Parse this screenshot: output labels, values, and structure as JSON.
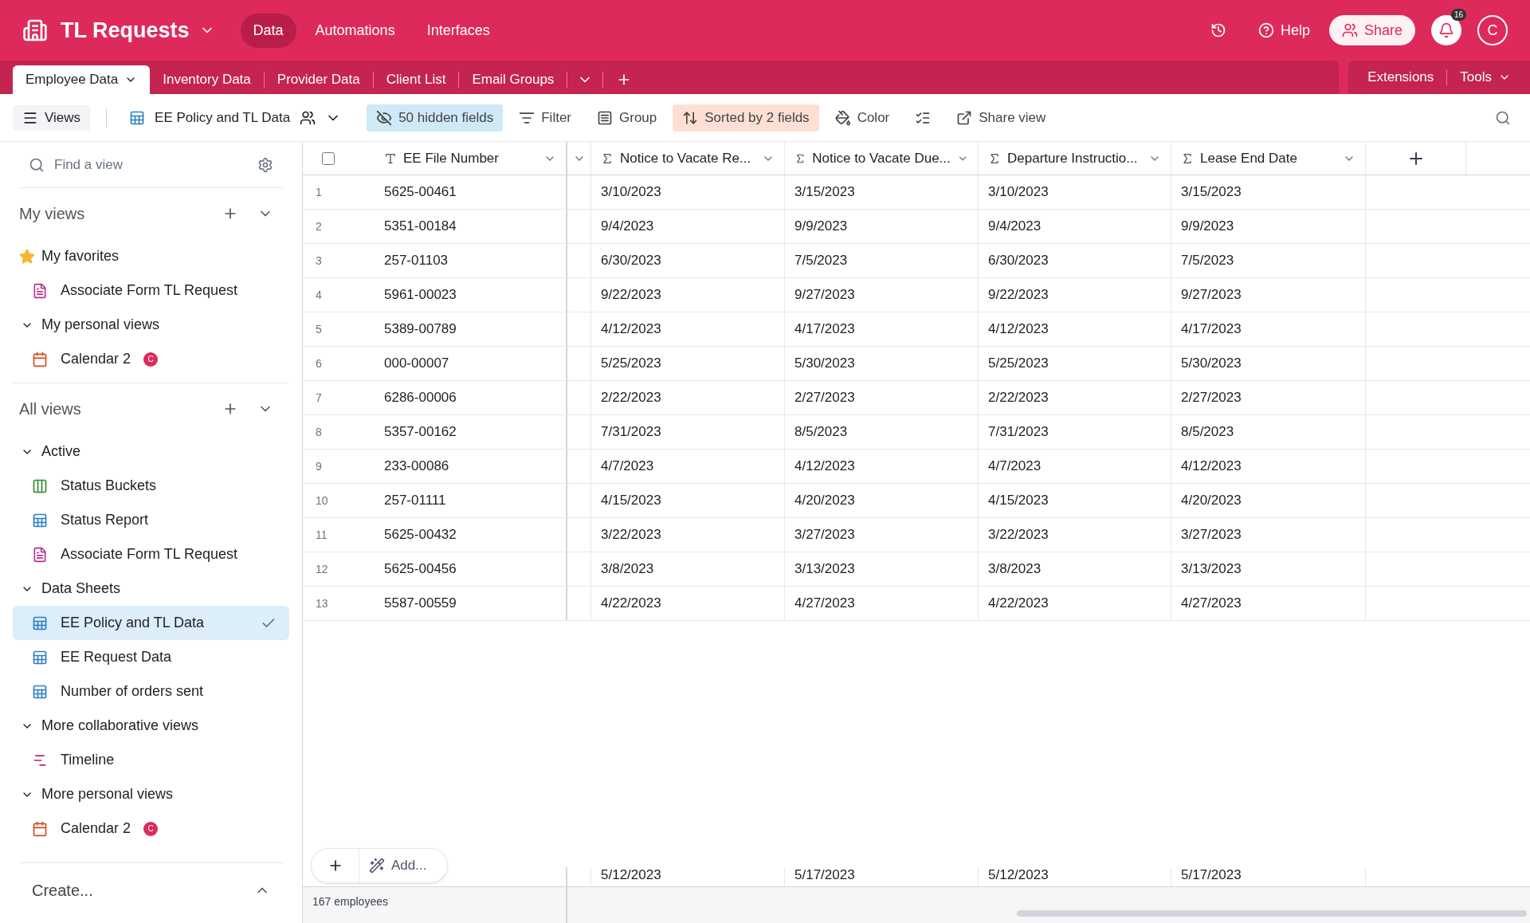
{
  "app": {
    "title": "TL Requests",
    "nav": [
      {
        "label": "Data",
        "selected": true
      },
      {
        "label": "Automations",
        "selected": false
      },
      {
        "label": "Interfaces",
        "selected": false
      }
    ],
    "help": "Help",
    "share": "Share",
    "notifications": "16",
    "avatar": "C"
  },
  "tables": [
    {
      "label": "Employee Data",
      "selected": true
    },
    {
      "label": "Inventory Data",
      "selected": false
    },
    {
      "label": "Provider Data",
      "selected": false
    },
    {
      "label": "Client List",
      "selected": false
    },
    {
      "label": "Email Groups",
      "selected": false
    }
  ],
  "tools": [
    "Extensions",
    "Tools"
  ],
  "toolbar": {
    "views": "Views",
    "current_view": "EE Policy and TL Data",
    "hidden_fields": "50 hidden fields",
    "filter": "Filter",
    "group": "Group",
    "sort": "Sorted by 2 fields",
    "color_button": "Color",
    "share_view": "Share view"
  },
  "sidebar": {
    "search_placeholder": "Find a view",
    "sections": [
      {
        "title": "My views",
        "groups": [
          {
            "title": "My favorites",
            "kind": "favorites",
            "items": [
              {
                "label": "Associate Form TL Request",
                "kind": "form",
                "selected": false
              }
            ]
          },
          {
            "title": "My personal views",
            "kind": "folder",
            "expanded": true,
            "items": [
              {
                "label": "Calendar 2",
                "kind": "calendar",
                "selected": false,
                "badge": "C"
              }
            ]
          }
        ]
      },
      {
        "title": "All views",
        "groups": [
          {
            "title": "Active",
            "kind": "folder",
            "expanded": true,
            "items": [
              {
                "label": "Status Buckets",
                "kind": "kanban",
                "selected": false
              },
              {
                "label": "Status Report",
                "kind": "grid",
                "selected": false
              },
              {
                "label": "Associate Form TL Request",
                "kind": "form",
                "selected": false
              }
            ]
          },
          {
            "title": "Data Sheets",
            "kind": "folder",
            "expanded": true,
            "items": [
              {
                "label": "EE Policy and TL Data",
                "kind": "grid",
                "selected": true
              },
              {
                "label": "EE Request Data",
                "kind": "grid",
                "selected": false
              },
              {
                "label": "Number of orders sent",
                "kind": "grid",
                "selected": false
              }
            ]
          },
          {
            "title": "More collaborative views",
            "kind": "folder",
            "expanded": true,
            "items": [
              {
                "label": "Timeline",
                "kind": "timeline",
                "selected": false
              }
            ]
          },
          {
            "title": "More personal views",
            "kind": "folder",
            "expanded": true,
            "items": [
              {
                "label": "Calendar 2",
                "kind": "calendar",
                "selected": false,
                "badge": "C"
              }
            ]
          }
        ]
      }
    ],
    "create": "Create..."
  },
  "table": {
    "columns": [
      {
        "label": "EE File Number",
        "kind": "text"
      },
      {
        "label": "Notice to Vacate Re...",
        "kind": "formula"
      },
      {
        "label": "Notice to Vacate Due...",
        "kind": "formula"
      },
      {
        "label": "Departure Instructio...",
        "kind": "formula"
      },
      {
        "label": "Lease End Date",
        "kind": "formula"
      }
    ],
    "select_all": {
      "checked": false
    },
    "rows": [
      {
        "number": "1",
        "cells": [
          "5625-00461",
          "3/10/2023",
          "3/15/2023",
          "3/10/2023",
          "3/15/2023"
        ]
      },
      {
        "number": "2",
        "cells": [
          "5351-00184",
          "9/4/2023",
          "9/9/2023",
          "9/4/2023",
          "9/9/2023"
        ]
      },
      {
        "number": "3",
        "cells": [
          "257-01103",
          "6/30/2023",
          "7/5/2023",
          "6/30/2023",
          "7/5/2023"
        ]
      },
      {
        "number": "4",
        "cells": [
          "5961-00023",
          "9/22/2023",
          "9/27/2023",
          "9/22/2023",
          "9/27/2023"
        ]
      },
      {
        "number": "5",
        "cells": [
          "5389-00789",
          "4/12/2023",
          "4/17/2023",
          "4/12/2023",
          "4/17/2023"
        ]
      },
      {
        "number": "6",
        "cells": [
          "000-00007",
          "5/25/2023",
          "5/30/2023",
          "5/25/2023",
          "5/30/2023"
        ]
      },
      {
        "number": "7",
        "cells": [
          "6286-00006",
          "2/22/2023",
          "2/27/2023",
          "2/22/2023",
          "2/27/2023"
        ]
      },
      {
        "number": "8",
        "cells": [
          "5357-00162",
          "7/31/2023",
          "8/5/2023",
          "7/31/2023",
          "8/5/2023"
        ]
      },
      {
        "number": "9",
        "cells": [
          "233-00086",
          "4/7/2023",
          "4/12/2023",
          "4/7/2023",
          "4/12/2023"
        ]
      },
      {
        "number": "10",
        "cells": [
          "257-01111",
          "4/15/2023",
          "4/20/2023",
          "4/15/2023",
          "4/20/2023"
        ]
      },
      {
        "number": "11",
        "cells": [
          "5625-00432",
          "3/22/2023",
          "3/27/2023",
          "3/22/2023",
          "3/27/2023"
        ]
      },
      {
        "number": "12",
        "cells": [
          "5625-00456",
          "3/8/2023",
          "3/13/2023",
          "3/8/2023",
          "3/13/2023"
        ]
      },
      {
        "number": "13",
        "cells": [
          "5587-00559",
          "4/22/2023",
          "4/27/2023",
          "4/22/2023",
          "4/27/2023"
        ]
      }
    ],
    "partial_row": {
      "cells": [
        "5/12/2023",
        "5/17/2023",
        "5/12/2023",
        "5/17/2023"
      ]
    },
    "add_label": "Add...",
    "record_count": "167 employees"
  }
}
